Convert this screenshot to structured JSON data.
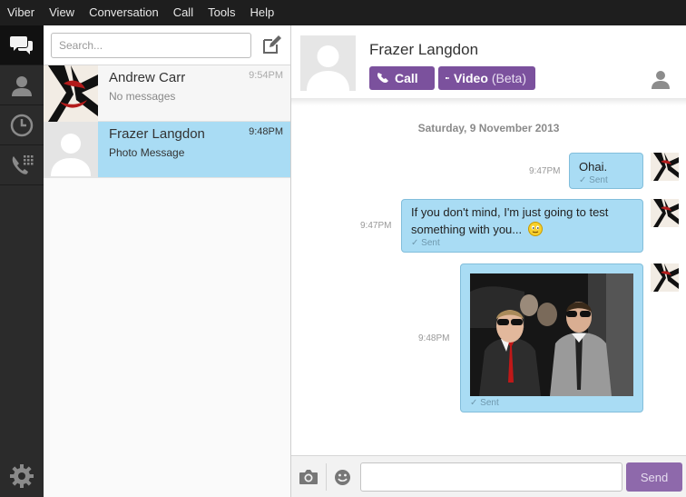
{
  "menu": [
    "Viber",
    "View",
    "Conversation",
    "Call",
    "Tools",
    "Help"
  ],
  "sidebar": {
    "icons": [
      "chat-icon",
      "contacts-icon",
      "recent-calls-icon",
      "dialpad-icon",
      "settings-icon"
    ]
  },
  "search": {
    "placeholder": "Search..."
  },
  "conversations": [
    {
      "name": "Andrew Carr",
      "subtitle": "No messages",
      "time": "9:54PM"
    },
    {
      "name": "Frazer Langdon",
      "subtitle": "Photo Message",
      "time": "9:48PM"
    }
  ],
  "chat": {
    "contact_name": "Frazer Langdon",
    "call_label": "Call",
    "video_label": "Video",
    "video_beta": "(Beta)",
    "date_header": "Saturday, 9 November 2013",
    "messages": [
      {
        "time": "9:47PM",
        "text": "Ohai.",
        "status": "Sent"
      },
      {
        "time": "9:47PM",
        "text_line1": "If you don't mind, I'm just going to test",
        "text_line2": "something with you...",
        "status": "Sent"
      },
      {
        "time": "9:48PM",
        "type": "photo",
        "status": "Sent"
      }
    ],
    "send_label": "Send"
  },
  "colors": {
    "accent": "#7b519d",
    "selected": "#a9dcf4",
    "menubar": "#1e1e1e",
    "sidebar": "#2b2b2b"
  }
}
